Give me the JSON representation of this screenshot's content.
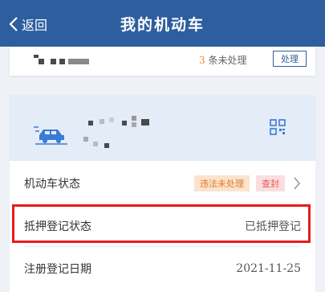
{
  "header": {
    "back_label": "返回",
    "title": "我的机动车"
  },
  "violations": {
    "count": "3",
    "text": "条未处理",
    "action_label": "处理"
  },
  "vehicle": {
    "status_label": "机动车状态",
    "status_tags": [
      "违法未处理",
      "查封"
    ],
    "mortgage_label": "抵押登记状态",
    "mortgage_value": "已抵押登记",
    "register_date_label": "注册登记日期",
    "register_date_value": "2021-11-25"
  },
  "colors": {
    "header_bg": "#2d5f9e",
    "highlight": "#e61b1b",
    "accent": "#3a7bd5"
  }
}
